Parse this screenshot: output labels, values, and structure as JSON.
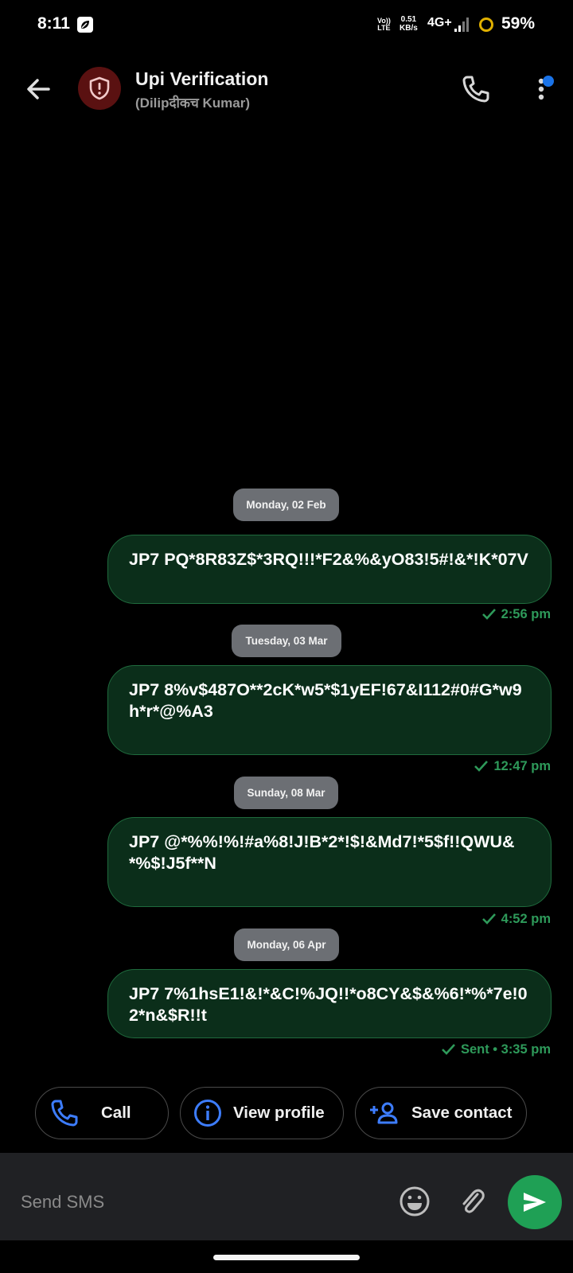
{
  "status_bar": {
    "time": "8:11",
    "volte_top": "Vo))",
    "volte_bottom": "LTE",
    "speed_value": "0.51",
    "speed_unit": "KB/s",
    "network": "4G+",
    "battery": "59%"
  },
  "header": {
    "title": "Upi Verification",
    "subtitle": "(Dilipदीकच Kumar)",
    "avatar_icon": "shield-alert-icon"
  },
  "messages": [
    {
      "date": "Monday, 02 Feb",
      "text": "JP7 PQ*8R83Z$*3RQ!!!*F2&%&yO83!5#!&*!K*07V",
      "time": "2:56 pm"
    },
    {
      "date": "Tuesday, 03 Mar",
      "text": "JP7 8%v$487O**2cK*w5*$1yEF!67&I112#0#G*w9h*r*@%A3",
      "time": "12:47 pm"
    },
    {
      "date": "Sunday, 08 Mar",
      "text": "JP7 @*%%!%!#a%8!J!B*2*!$!&Md7!*5$f!!QWU&*%$!J5f**N",
      "time": "4:52 pm"
    },
    {
      "date": "Monday, 06 Apr",
      "text": "JP7 7%1hsE1!&!*&C!%JQ!!*o8CY&$&%6!*%*7e!02*n&$R!!t",
      "time": "Sent • 3:35 pm"
    }
  ],
  "actions": {
    "call": "Call",
    "view_profile": "View profile",
    "save_contact": "Save contact"
  },
  "composer": {
    "placeholder": "Send SMS"
  },
  "colors": {
    "bubble_bg": "#0b2e1a",
    "accent_green": "#1fa055",
    "icon_blue": "#3d7dff",
    "unread_dot": "#1a73e8"
  }
}
